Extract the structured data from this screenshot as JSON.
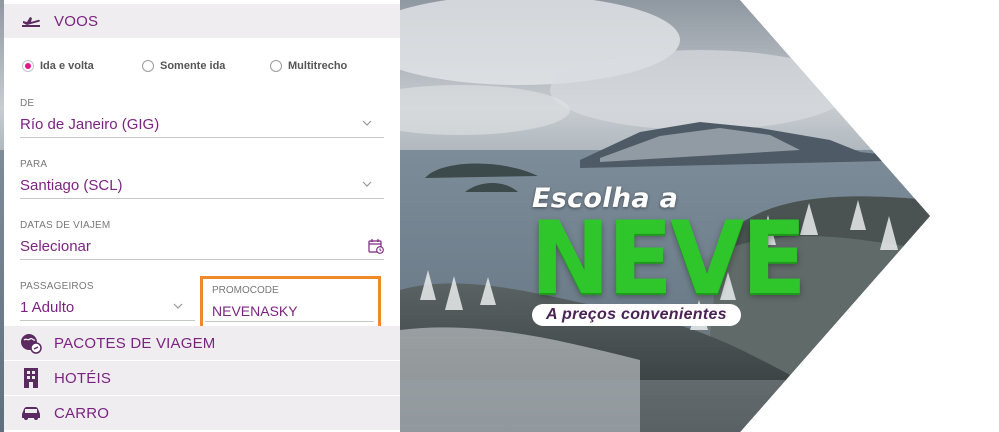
{
  "flights": {
    "title": "VOOS",
    "trip_options": [
      "Ida e volta",
      "Somente ida",
      "Multitrecho"
    ],
    "selected_trip": "Ida e volta",
    "from": {
      "label": "DE",
      "value": "Río de Janeiro (GIG)"
    },
    "to": {
      "label": "PARA",
      "value": "Santiago (SCL)"
    },
    "dates": {
      "label": "DATAS DE VIAJEM",
      "value": "Selecionar"
    },
    "passengers": {
      "label": "PASSAGEIROS",
      "value": "1 Adulto"
    },
    "promocode": {
      "label": "PROMOCODE",
      "value": "NEVENASKY"
    }
  },
  "sections": {
    "packages": "PACOTES DE VIAGEM",
    "hotels": "HOTÉIS",
    "car": "CARRO"
  },
  "banner": {
    "pre_title": "Escolha a",
    "big_title": "NEVE",
    "subtitle": "A preços convenientes"
  },
  "colors": {
    "brand_purple": "#7b2381",
    "accent_pink": "#e0188c",
    "promo_highlight": "#f08a28",
    "neve_green": "#2fc62b"
  },
  "icons": {
    "flights": "plane-takeoff-icon",
    "packages": "globe-plane-icon",
    "hotels": "building-icon",
    "car": "car-icon"
  }
}
